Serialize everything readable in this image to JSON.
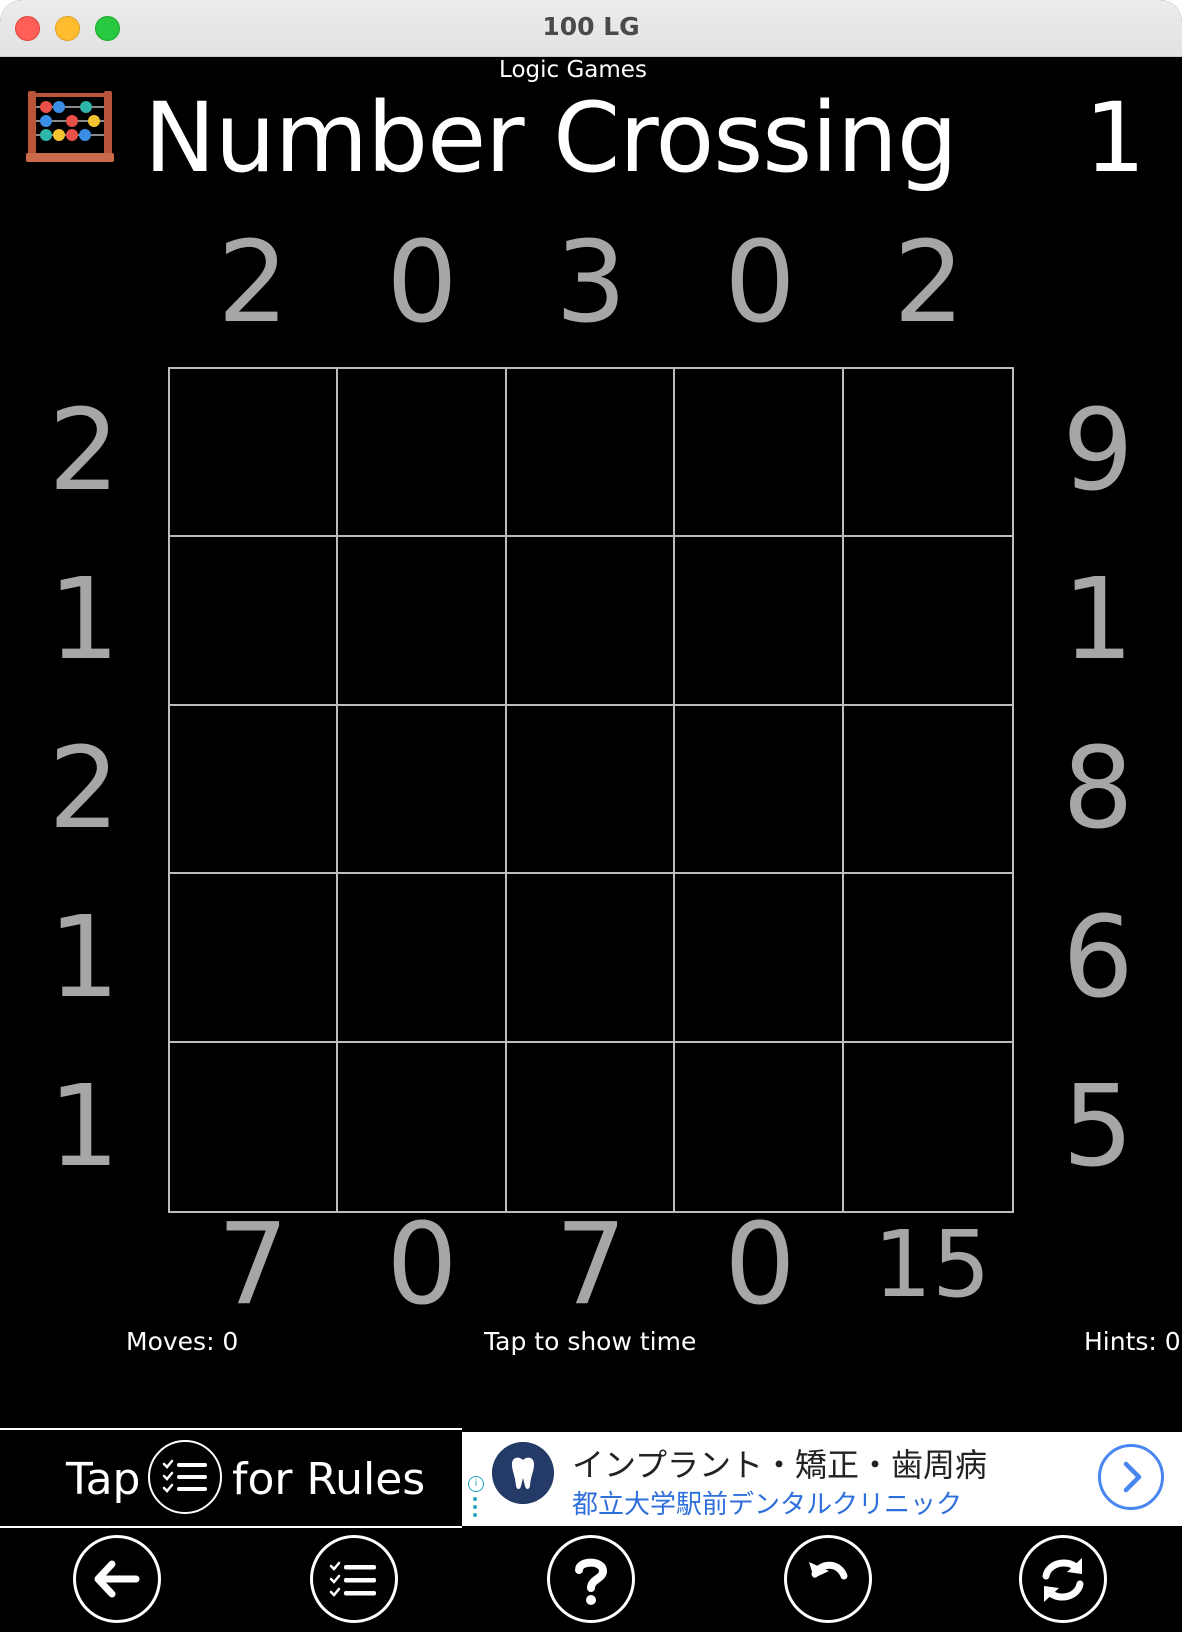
{
  "window": {
    "title": "100 LG"
  },
  "header": {
    "subtitle": "Logic Games",
    "game_title": "Number Crossing",
    "level": "1",
    "logo_icon": "abacus-icon"
  },
  "puzzle": {
    "top_clues": [
      "2",
      "0",
      "3",
      "0",
      "2"
    ],
    "bottom_clues": [
      "7",
      "0",
      "7",
      "0",
      "15"
    ],
    "left_clues": [
      "2",
      "1",
      "2",
      "1",
      "1"
    ],
    "right_clues": [
      "9",
      "1",
      "8",
      "6",
      "5"
    ],
    "grid_size": 5,
    "clue_color": "#a6a6a6",
    "grid_line_color": "#bdbdbd"
  },
  "status": {
    "moves": "Moves: 0",
    "time": "Tap to show time",
    "hints": "Hints: 0"
  },
  "rules": {
    "tap": "Tap",
    "for_rules": "for Rules",
    "icon": "checklist-icon"
  },
  "ad": {
    "line1": "インプラント・矯正・歯周病",
    "line2": "都立大学駅前デンタルクリニック",
    "info_icon": "info-icon",
    "logo_icon": "tooth-logo-icon",
    "arrow_icon": "chevron-right-icon",
    "link_color": "#2f6fdb"
  },
  "toolbar": {
    "buttons": [
      {
        "icon": "back-arrow-icon"
      },
      {
        "icon": "checklist-icon"
      },
      {
        "icon": "question-icon"
      },
      {
        "icon": "undo-icon"
      },
      {
        "icon": "refresh-icon"
      }
    ]
  }
}
